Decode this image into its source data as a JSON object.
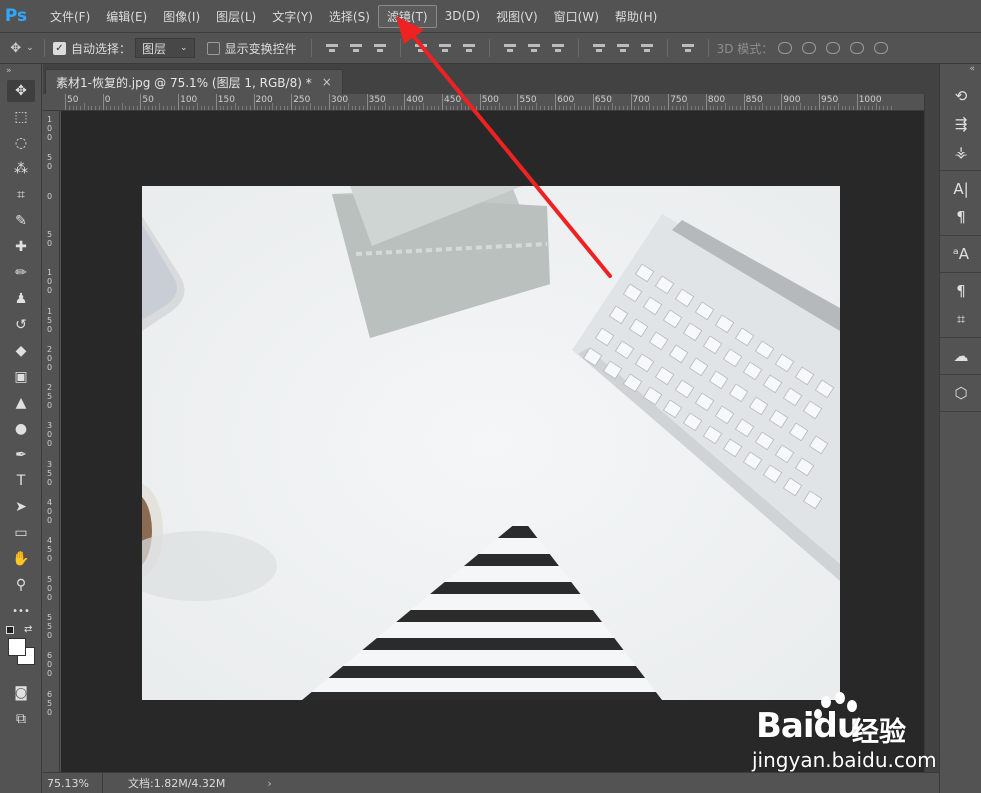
{
  "app": {
    "logo": "Ps"
  },
  "menu": {
    "items": [
      {
        "label": "文件(F)",
        "name": "menu-file"
      },
      {
        "label": "编辑(E)",
        "name": "menu-edit"
      },
      {
        "label": "图像(I)",
        "name": "menu-image"
      },
      {
        "label": "图层(L)",
        "name": "menu-layer"
      },
      {
        "label": "文字(Y)",
        "name": "menu-type"
      },
      {
        "label": "选择(S)",
        "name": "menu-select"
      },
      {
        "label": "滤镜(T)",
        "name": "menu-filter",
        "active": true
      },
      {
        "label": "3D(D)",
        "name": "menu-3d"
      },
      {
        "label": "视图(V)",
        "name": "menu-view"
      },
      {
        "label": "窗口(W)",
        "name": "menu-window"
      },
      {
        "label": "帮助(H)",
        "name": "menu-help"
      }
    ]
  },
  "options": {
    "auto_select_label": "自动选择：",
    "auto_select_checked": true,
    "auto_select_value": "图层",
    "show_transform_label": "显示变换控件",
    "show_transform_checked": false,
    "mode_3d_label": "3D 模式："
  },
  "document": {
    "tab_title": "素材1-恢复的.jpg @ 75.1% (图层 1, RGB/8) *",
    "close_glyph": "×"
  },
  "ruler": {
    "top_labels": [
      "50",
      "0",
      "50",
      "100",
      "150",
      "200",
      "250",
      "300",
      "350",
      "400",
      "450",
      "500",
      "550",
      "600",
      "650",
      "700",
      "750",
      "800",
      "850",
      "900",
      "950",
      "1000"
    ],
    "left_labels": [
      "100",
      "50",
      "0",
      "50",
      "100",
      "150",
      "200",
      "250",
      "300",
      "350",
      "400",
      "450",
      "500",
      "550",
      "600",
      "650"
    ]
  },
  "status": {
    "zoom": "75.13%",
    "doc_size": "文档:1.82M/4.32M",
    "arrow": "›"
  },
  "tools": [
    {
      "name": "move-tool-icon",
      "glyph": "✥",
      "selected": true
    },
    {
      "name": "marquee-tool-icon",
      "glyph": "⬚"
    },
    {
      "name": "lasso-tool-icon",
      "glyph": "◌"
    },
    {
      "name": "magic-wand-tool-icon",
      "glyph": "⁂"
    },
    {
      "name": "crop-tool-icon",
      "glyph": "⌗"
    },
    {
      "name": "eyedropper-tool-icon",
      "glyph": "✎"
    },
    {
      "name": "healing-brush-tool-icon",
      "glyph": "✚"
    },
    {
      "name": "brush-tool-icon",
      "glyph": "✏"
    },
    {
      "name": "clone-stamp-tool-icon",
      "glyph": "♟"
    },
    {
      "name": "history-brush-tool-icon",
      "glyph": "↺"
    },
    {
      "name": "eraser-tool-icon",
      "glyph": "◆"
    },
    {
      "name": "gradient-tool-icon",
      "glyph": "▣"
    },
    {
      "name": "blur-tool-icon",
      "glyph": "▲"
    },
    {
      "name": "dodge-tool-icon",
      "glyph": "●"
    },
    {
      "name": "pen-tool-icon",
      "glyph": "✒"
    },
    {
      "name": "type-tool-icon",
      "glyph": "T"
    },
    {
      "name": "path-selection-tool-icon",
      "glyph": "➤"
    },
    {
      "name": "rectangle-tool-icon",
      "glyph": "▭"
    },
    {
      "name": "hand-tool-icon",
      "glyph": "✋"
    },
    {
      "name": "zoom-tool-icon",
      "glyph": "⚲"
    },
    {
      "name": "more-tools-icon",
      "glyph": "•••"
    }
  ],
  "tools_bottom": [
    {
      "name": "quick-mask-icon",
      "glyph": "◙"
    },
    {
      "name": "screen-mode-icon",
      "glyph": "⧉"
    }
  ],
  "right_panel": [
    [
      {
        "name": "history-panel-icon",
        "glyph": "⟲"
      },
      {
        "name": "adjustments-panel-icon",
        "glyph": "⇶"
      },
      {
        "name": "brush-presets-panel-icon",
        "glyph": "⚶"
      }
    ],
    [
      {
        "name": "character-panel-icon",
        "glyph": "A|"
      },
      {
        "name": "paragraph-panel-icon",
        "glyph": "¶"
      }
    ],
    [
      {
        "name": "character-styles-panel-icon",
        "glyph": "ᵃA"
      }
    ],
    [
      {
        "name": "paragraph-styles-panel-icon",
        "glyph": "¶"
      },
      {
        "name": "crop-panel-icon",
        "glyph": "⌗"
      }
    ],
    [
      {
        "name": "creative-cloud-panel-icon",
        "glyph": "☁"
      }
    ],
    [
      {
        "name": "3d-panel-icon",
        "glyph": "⬡"
      }
    ]
  ],
  "watermark": {
    "brand": "Bai",
    "brand_suffix": "du",
    "product": "经验",
    "url": "jingyan.baidu.com"
  },
  "colors": {
    "accent": "#31a8ff",
    "annotation": "#ee2222"
  }
}
